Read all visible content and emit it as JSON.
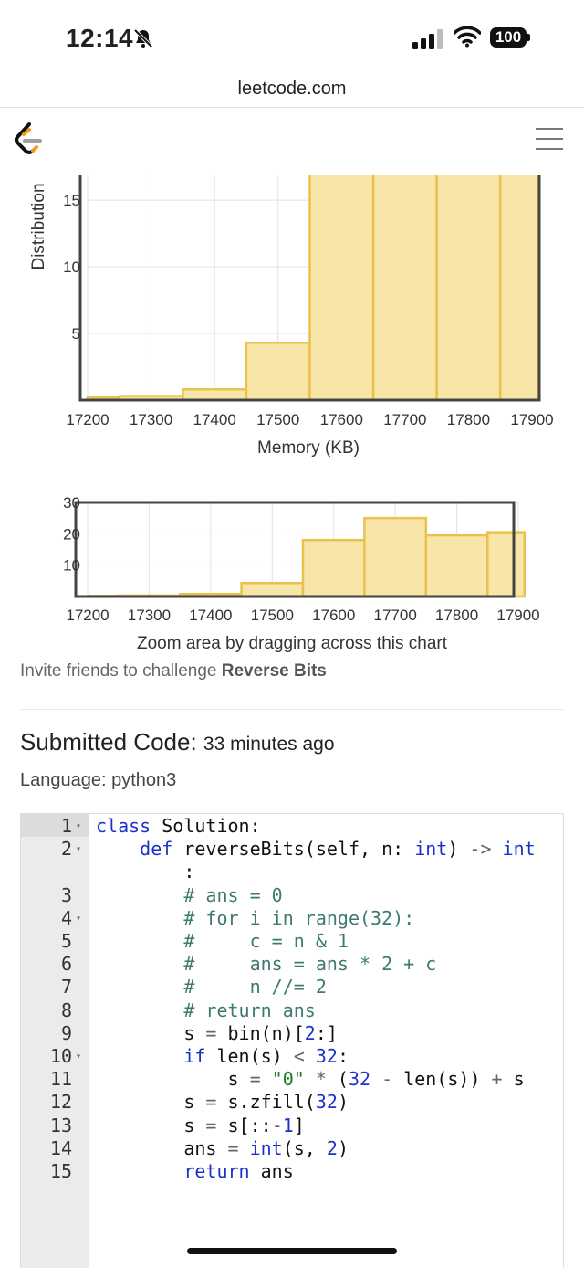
{
  "status_bar": {
    "time": "12:14",
    "battery": "100"
  },
  "browser": {
    "url": "leetcode.com"
  },
  "memory_chart": {
    "ylabel": "Distribution",
    "xlabel": "Memory (KB)",
    "yticks": [
      "5",
      "10",
      "15"
    ],
    "xticks": [
      "17200",
      "17300",
      "17400",
      "17500",
      "17600",
      "17700",
      "17800",
      "17900"
    ]
  },
  "zoom_chart": {
    "yticks": [
      "10",
      "20",
      "30"
    ],
    "xticks": [
      "17200",
      "17300",
      "17400",
      "17500",
      "17600",
      "17700",
      "17800",
      "17900"
    ],
    "hint": "Zoom area by dragging across this chart"
  },
  "chart_data": [
    {
      "type": "bar",
      "xlabel": "Memory (KB)",
      "ylabel": "Distribution",
      "xlim": [
        17200,
        17900
      ],
      "ylim": [
        0,
        17
      ],
      "bins": [
        {
          "start": 17200,
          "end": 17250,
          "value": 0.2
        },
        {
          "start": 17250,
          "end": 17350,
          "value": 0.3
        },
        {
          "start": 17350,
          "end": 17450,
          "value": 0.8
        },
        {
          "start": 17450,
          "end": 17550,
          "value": 4.3
        },
        {
          "start": 17550,
          "end": 17650,
          "value": 18
        },
        {
          "start": 17650,
          "end": 17750,
          "value": 25
        },
        {
          "start": 17750,
          "end": 17850,
          "value": 19.5
        },
        {
          "start": 17850,
          "end": 17910,
          "value": 20.5
        }
      ]
    },
    {
      "type": "bar",
      "xlim": [
        17200,
        17900
      ],
      "ylim": [
        0,
        30
      ],
      "bins": [
        {
          "start": 17200,
          "end": 17250,
          "value": 0.2
        },
        {
          "start": 17250,
          "end": 17350,
          "value": 0.3
        },
        {
          "start": 17350,
          "end": 17450,
          "value": 0.8
        },
        {
          "start": 17450,
          "end": 17550,
          "value": 4.3
        },
        {
          "start": 17550,
          "end": 17650,
          "value": 18
        },
        {
          "start": 17650,
          "end": 17750,
          "value": 25
        },
        {
          "start": 17750,
          "end": 17850,
          "value": 19.5
        },
        {
          "start": 17850,
          "end": 17910,
          "value": 20.5
        }
      ]
    }
  ],
  "invite": {
    "prefix": "Invite friends to challenge",
    "problem": "Reverse Bits"
  },
  "submission": {
    "heading": "Submitted Code:",
    "time_ago": "33 minutes ago",
    "language": "Language: python3"
  },
  "code": {
    "lines": [
      {
        "num": "1",
        "fold": true,
        "text": "class Solution:"
      },
      {
        "num": "2",
        "fold": true,
        "text": "    def reverseBits(self, n: int) -> int"
      },
      {
        "num": "",
        "fold": false,
        "text": "        :"
      },
      {
        "num": "3",
        "fold": false,
        "text": "        # ans = 0"
      },
      {
        "num": "4",
        "fold": true,
        "text": "        # for i in range(32):"
      },
      {
        "num": "5",
        "fold": false,
        "text": "        #     c = n & 1"
      },
      {
        "num": "6",
        "fold": false,
        "text": "        #     ans = ans * 2 + c"
      },
      {
        "num": "7",
        "fold": false,
        "text": "        #     n //= 2"
      },
      {
        "num": "8",
        "fold": false,
        "text": "        # return ans"
      },
      {
        "num": "9",
        "fold": false,
        "text": "        s = bin(n)[2:]"
      },
      {
        "num": "10",
        "fold": true,
        "text": "        if len(s) < 32:"
      },
      {
        "num": "11",
        "fold": false,
        "text": "            s = \"0\" * (32 - len(s)) + s"
      },
      {
        "num": "12",
        "fold": false,
        "text": "        s = s.zfill(32)"
      },
      {
        "num": "13",
        "fold": false,
        "text": "        s = s[::-1]"
      },
      {
        "num": "14",
        "fold": false,
        "text": "        ans = int(s, 2)"
      },
      {
        "num": "15",
        "fold": false,
        "text": "        return ans"
      }
    ]
  },
  "colors": {
    "bar_fill": "#f8e6a8",
    "bar_stroke": "#e8c24a",
    "keyword": "#1c33c9",
    "comment": "#3d7a6f",
    "string": "#217a21"
  },
  "icons": [
    "bell-slash-icon",
    "cellular-signal-icon",
    "wifi-icon",
    "battery-icon",
    "leetcode-logo-icon",
    "hamburger-menu-icon"
  ]
}
